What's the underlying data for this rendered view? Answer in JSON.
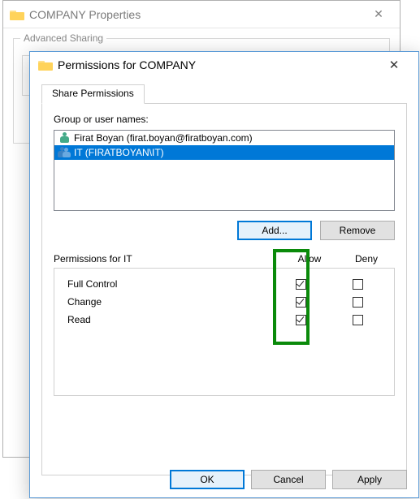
{
  "back_window": {
    "title": "COMPANY Properties",
    "group_label": "Advanced Sharing"
  },
  "front_window": {
    "title": "Permissions for COMPANY",
    "tab_label": "Share Permissions",
    "group_label": "Group or user names:",
    "users": [
      {
        "display": "Firat Boyan (firat.boyan@firatboyan.com)",
        "type": "user",
        "selected": false
      },
      {
        "display": "IT (FIRATBOYAN\\IT)",
        "type": "group",
        "selected": true
      }
    ],
    "add_label": "Add...",
    "remove_label": "Remove",
    "perm_header_label": "Permissions for IT",
    "col_allow": "Allow",
    "col_deny": "Deny",
    "permissions": [
      {
        "name": "Full Control",
        "allow": true,
        "deny": false
      },
      {
        "name": "Change",
        "allow": true,
        "deny": false
      },
      {
        "name": "Read",
        "allow": true,
        "deny": false
      }
    ],
    "buttons": {
      "ok": "OK",
      "cancel": "Cancel",
      "apply": "Apply"
    }
  }
}
